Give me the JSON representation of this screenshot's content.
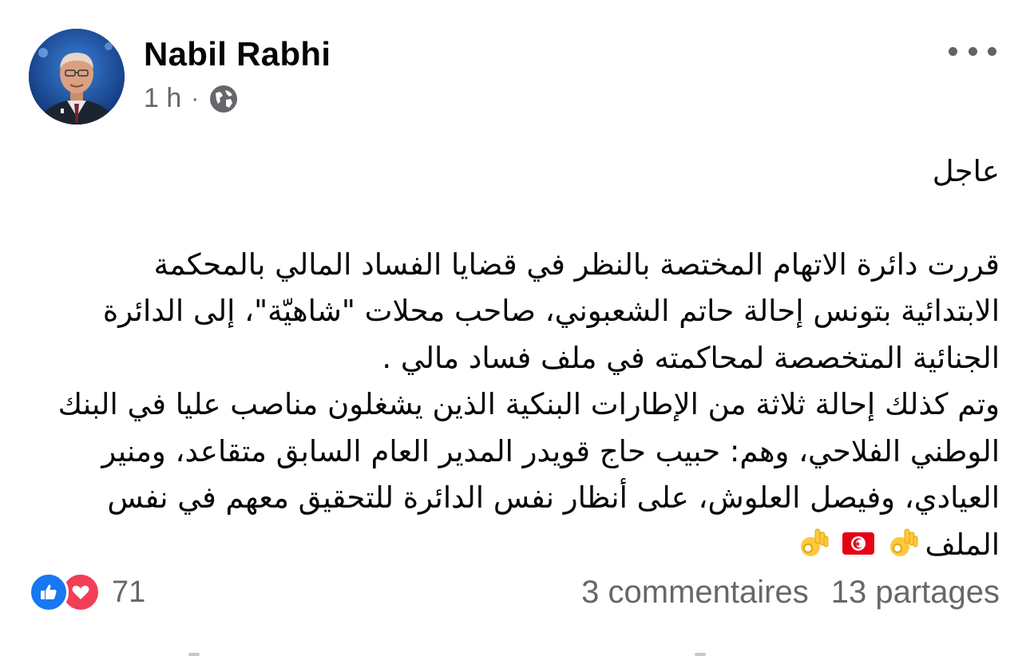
{
  "post": {
    "author": "Nabil Rabhi",
    "time": "1 h",
    "separator": "·",
    "privacy_icon": "globe-icon",
    "menu_icon": "more-options-icon",
    "body": {
      "line1": "عاجل",
      "paragraph1": "قررت دائرة الاتهام المختصة بالنظر في قضايا الفساد المالي بالمحكمة الابتدائية بتونس إحالة  حاتم الشعبوني، صاحب محلات \"شاهيّة\"، إلى الدائرة الجنائية المتخصصة لمحاكمته في ملف فساد مالي .",
      "paragraph2": " وتم كذلك إحالة ثلاثة من الإطارات البنكية الذين يشغلون مناصب عليا في البنك الوطني الفلاحي، وهم: حبيب حاج قويدر المدير العام السابق متقاعد، ومنير العيادي، وفيصل العلوش، على أنظار نفس الدائرة للتحقيق معهم في نفس الملف",
      "emojis": [
        "ok-hand",
        "tunisia-flag",
        "ok-hand"
      ]
    },
    "reactions": {
      "icons": [
        "like-icon",
        "love-icon"
      ],
      "count": "71"
    },
    "comments": "3 commentaires",
    "shares": "13 partages"
  }
}
